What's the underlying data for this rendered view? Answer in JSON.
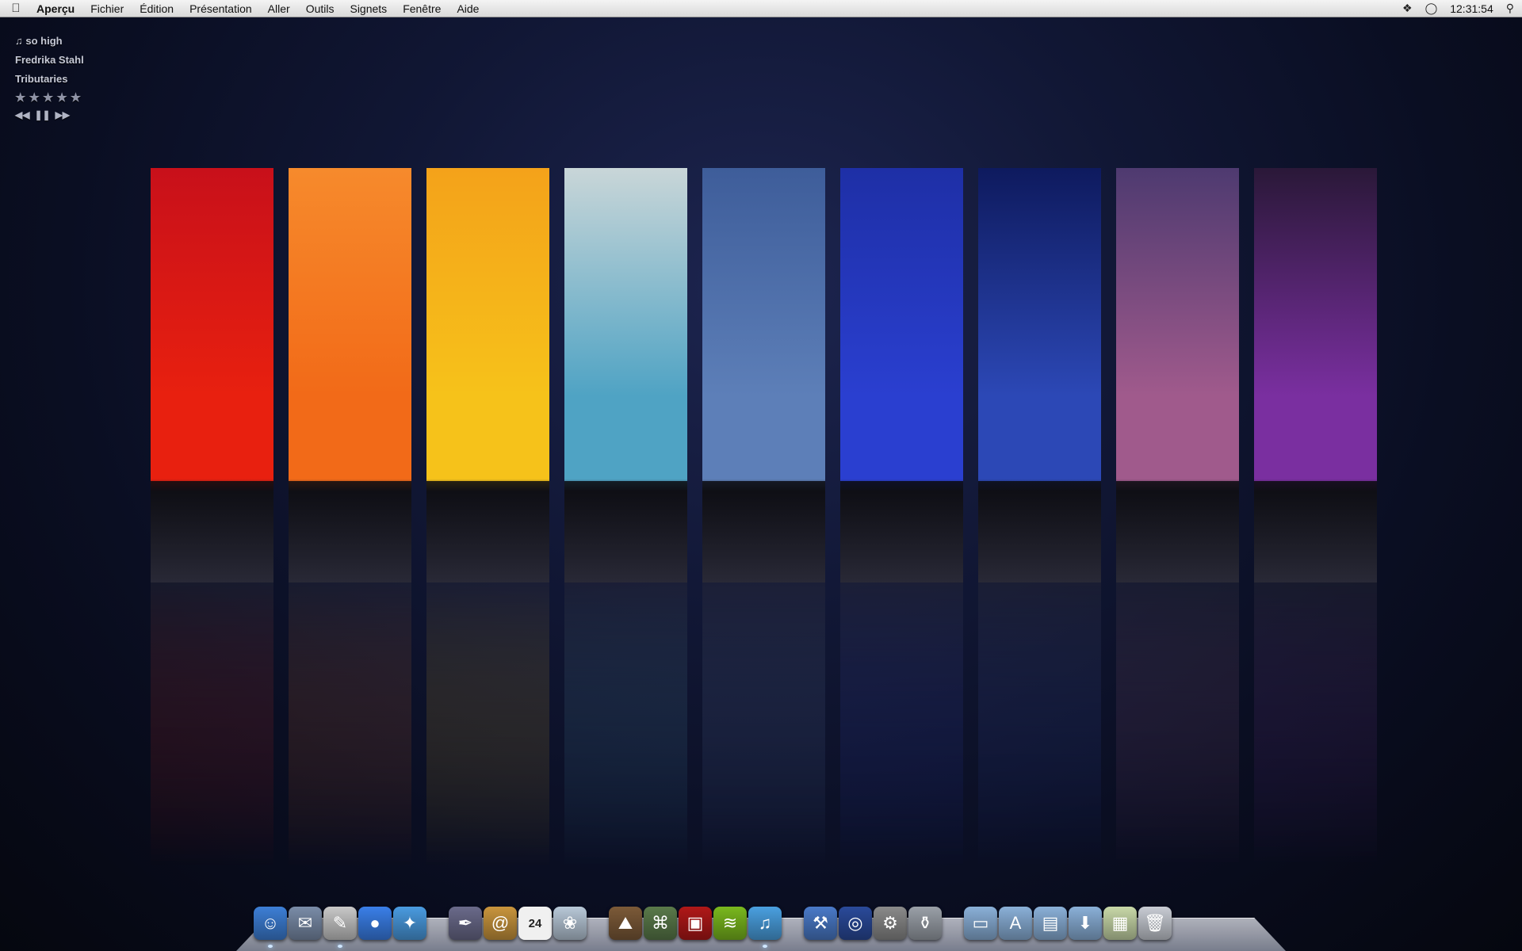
{
  "menubar": {
    "app_name": "Aperçu",
    "items": [
      "Fichier",
      "Édition",
      "Présentation",
      "Aller",
      "Outils",
      "Signets",
      "Fenêtre",
      "Aide"
    ],
    "clock": "12:31:54"
  },
  "now_playing": {
    "track": "♫ so high",
    "artist": "Fredrika Stahl",
    "album": "Tributaries",
    "rating_stars": "★★★★★",
    "controls": {
      "previous": "◀◀",
      "pause": "❚❚",
      "next": "▶▶"
    }
  },
  "wallpaper": {
    "panels": [
      {
        "name": "red",
        "sky": "#e8200f",
        "sky_top": "#c8101a"
      },
      {
        "name": "orange",
        "sky": "#f26a18",
        "sky_top": "#f68a2c"
      },
      {
        "name": "yellow",
        "sky": "#f6c21a",
        "sky_top": "#f4a21a"
      },
      {
        "name": "cyan",
        "sky": "#4fa3c4",
        "sky_top": "#c9d6d8"
      },
      {
        "name": "sky-blue",
        "sky": "#5d7fb8",
        "sky_top": "#3e5d9a"
      },
      {
        "name": "blue",
        "sky": "#2a3fd0",
        "sky_top": "#1e2fa6"
      },
      {
        "name": "navy",
        "sky": "#2c48b6",
        "sky_top": "#0e1a5e"
      },
      {
        "name": "violet",
        "sky": "#a05a8c",
        "sky_top": "#4e3a70"
      },
      {
        "name": "purple",
        "sky": "#7a2fa0",
        "sky_top": "#2a1838"
      }
    ]
  },
  "dock": {
    "icons": [
      {
        "name": "finder-icon",
        "glyph": "☺",
        "color": "#3d7fd6",
        "running": true
      },
      {
        "name": "mail-stamp-icon",
        "glyph": "✉",
        "color": "#7a8ca8",
        "running": false
      },
      {
        "name": "preview-icon",
        "glyph": "✎",
        "color": "#c8c8c8",
        "running": true
      },
      {
        "name": "ichat-icon",
        "glyph": "●",
        "color": "#3a7fe8",
        "running": false
      },
      {
        "name": "safari-icon",
        "glyph": "✦",
        "color": "#4a9be0",
        "running": false
      },
      {
        "name": "gap"
      },
      {
        "name": "script-editor-icon",
        "glyph": "✒",
        "color": "#6a6a8a",
        "running": false
      },
      {
        "name": "address-book-icon",
        "glyph": "@",
        "color": "#c9953d",
        "running": false
      },
      {
        "name": "ical-icon",
        "glyph": "24",
        "color": "#f0f0f0",
        "running": false
      },
      {
        "name": "preview-viewer-icon",
        "glyph": "❀",
        "color": "#b8c8d8",
        "running": false
      },
      {
        "name": "gap"
      },
      {
        "name": "iphoto-icon",
        "glyph": "⛰",
        "color": "#7c5a38",
        "running": false
      },
      {
        "name": "image-capture-icon",
        "glyph": "⌘",
        "color": "#5a7a4a",
        "running": false
      },
      {
        "name": "photo-booth-icon",
        "glyph": "▣",
        "color": "#b01818",
        "running": false
      },
      {
        "name": "spotify-icon",
        "glyph": "≋",
        "color": "#7ab81e",
        "running": false
      },
      {
        "name": "itunes-icon",
        "glyph": "♫",
        "color": "#4aa0e0",
        "running": true
      },
      {
        "name": "gap"
      },
      {
        "name": "xcode-icon",
        "glyph": "⚒",
        "color": "#4a7ac8",
        "running": false
      },
      {
        "name": "time-machine-icon",
        "glyph": "◎",
        "color": "#2a4a9a",
        "running": false
      },
      {
        "name": "system-preferences-icon",
        "glyph": "⚙",
        "color": "#8a8a8a",
        "running": false
      },
      {
        "name": "utilities-icon",
        "glyph": "⚱",
        "color": "#9aa0a8",
        "running": false
      },
      {
        "name": "gap"
      },
      {
        "name": "stack-folder-icon",
        "glyph": "▭",
        "color": "#8ab0d8",
        "running": false
      },
      {
        "name": "applications-folder-icon",
        "glyph": "A",
        "color": "#8ab0d8",
        "running": false
      },
      {
        "name": "documents-folder-icon",
        "glyph": "▤",
        "color": "#8ab0d8",
        "running": false
      },
      {
        "name": "downloads-folder-icon",
        "glyph": "⬇",
        "color": "#8ab0d8",
        "running": false
      },
      {
        "name": "screenshot-icon",
        "glyph": "▦",
        "color": "#c8d8a8",
        "running": false
      },
      {
        "name": "trash-icon",
        "glyph": "🗑",
        "color": "#c8ccd4",
        "running": false
      }
    ]
  }
}
